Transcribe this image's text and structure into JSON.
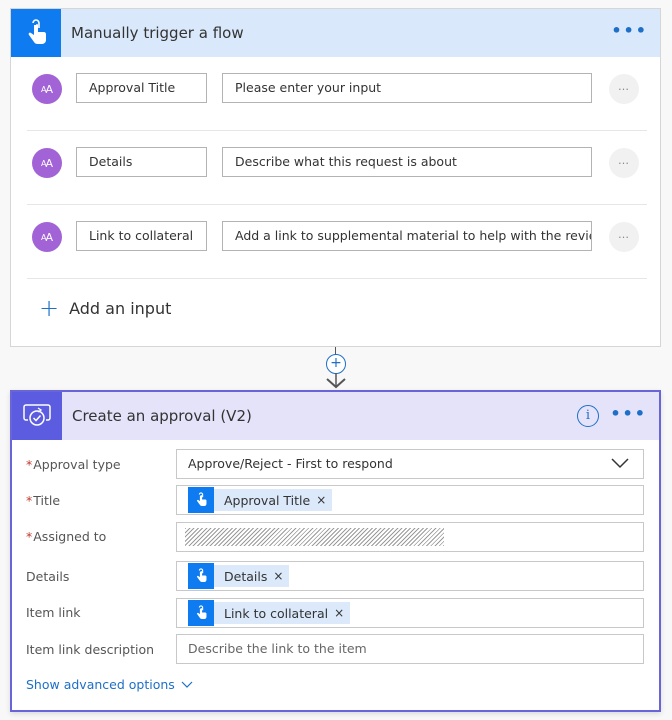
{
  "trigger": {
    "title": "Manually trigger a flow",
    "more_label": "•••",
    "inputs": [
      {
        "avatar": "AA",
        "name": "Approval Title",
        "description": "Please enter your input"
      },
      {
        "avatar": "AA",
        "name": "Details",
        "description": "Describe what this request is about"
      },
      {
        "avatar": "AA",
        "name": "Link to collateral",
        "description": "Add a link to supplemental material to help with the review"
      }
    ],
    "row_more_label": "…",
    "add_input": {
      "icon": "+",
      "label": "Add an input"
    }
  },
  "connector": {
    "icon": "+"
  },
  "approval": {
    "title": "Create an approval (V2)",
    "info_label": "i",
    "more_label": "•••",
    "fields": {
      "approval_type": {
        "label": "Approval type",
        "required": true,
        "value": "Approve/Reject - First to respond"
      },
      "title": {
        "label": "Title",
        "required": true,
        "token": "Approval Title"
      },
      "assigned_to": {
        "label": "Assigned to",
        "required": true,
        "value": ""
      },
      "details": {
        "label": "Details",
        "required": false,
        "token": "Details"
      },
      "item_link": {
        "label": "Item link",
        "required": false,
        "token": "Link to collateral"
      },
      "item_link_description": {
        "label": "Item link description",
        "required": false,
        "placeholder": "Describe the link to the item"
      }
    },
    "required_marker": "*",
    "token_remove": "×",
    "show_advanced": "Show advanced options"
  },
  "colors": {
    "trigger_accent": "#0f7bf0",
    "trigger_header_bg": "#d9e9fb",
    "approval_accent": "#5c5ce0",
    "approval_header_bg": "#e4e3fa",
    "link_blue": "#1e6fc7",
    "avatar_purple": "#a263d6",
    "required_red": "#c0392b"
  }
}
